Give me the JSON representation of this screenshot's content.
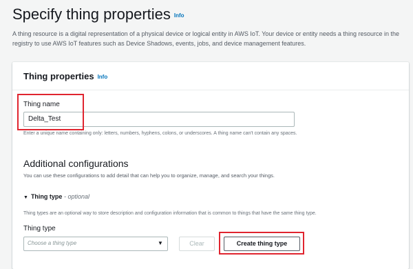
{
  "header": {
    "title": "Specify thing properties",
    "info": "Info",
    "description": "A thing resource is a digital representation of a physical device or logical entity in AWS IoT. Your device or entity needs a thing resource in the registry to use AWS IoT features such as Device Shadows, events, jobs, and device management features."
  },
  "thing_properties": {
    "title": "Thing properties",
    "info": "Info",
    "name_label": "Thing name",
    "name_value": "Delta_Test",
    "name_hint": "Enter a unique name containing only: letters, numbers, hyphens, colons, or underscores. A thing name can't contain any spaces."
  },
  "additional": {
    "title": "Additional configurations",
    "description": "You can use these configurations to add detail that can help you to organize, manage, and search your things.",
    "thing_type_toggle": "Thing type",
    "optional": "- optional",
    "thing_type_desc": "Thing types are an optional way to store description and configuration information that is common to things that have the same thing type.",
    "thing_type_label": "Thing type",
    "select_placeholder": "Choose a thing type",
    "clear_label": "Clear",
    "create_label": "Create thing type"
  },
  "colors": {
    "link": "#0073bb",
    "highlight": "#e0242f",
    "text": "#16191f",
    "muted": "#687078"
  },
  "icons": [
    "caret-down-icon",
    "select-caret-icon"
  ]
}
